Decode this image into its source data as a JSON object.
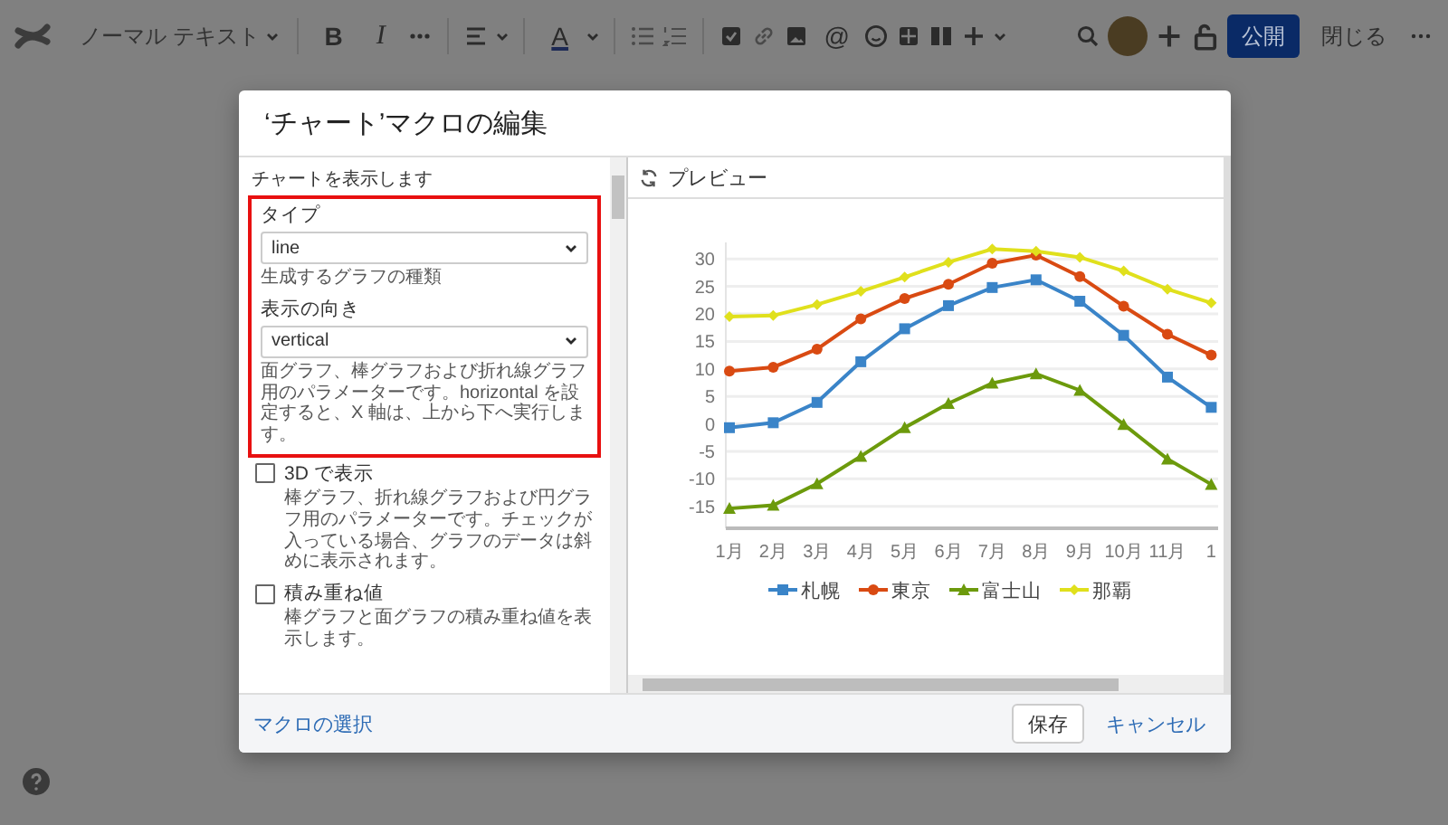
{
  "toolbar": {
    "text_style": "ノーマル テキスト",
    "bold": "B",
    "italic": "I",
    "text_color": "A",
    "mention": "@",
    "publish": "公開",
    "close": "閉じる"
  },
  "dialog": {
    "title": "‘チャート’マクロの編集",
    "intro": "チャートを表示します",
    "fields_highlighted": true,
    "fields": [
      {
        "kind": "select",
        "label": "タイプ",
        "value": "line",
        "help": "生成するグラフの種類"
      },
      {
        "kind": "select",
        "label": "表示の向き",
        "value": "vertical",
        "help": "面グラフ、棒グラフおよび折れ線グラフ用のパラメーターです。horizontal を設定すると、X 軸は、上から下へ実行します。"
      }
    ],
    "options": [
      {
        "label": "3D で表示",
        "checked": false,
        "help": "棒グラフ、折れ線グラフおよび円グラフ用のパラメーターです。チェックが入っている場合、グラフのデータは斜めに表示されます。"
      },
      {
        "label": "積み重ね値",
        "checked": false,
        "help": "棒グラフと面グラフの積み重ね値を表示します。"
      }
    ],
    "preview": {
      "title": "プレビュー",
      "chart_data": {
        "type": "line",
        "categories": [
          "1月",
          "2月",
          "3月",
          "4月",
          "5月",
          "6月",
          "7月",
          "8月",
          "9月",
          "10月",
          "11月",
          "1"
        ],
        "ylim": [
          -19,
          33
        ],
        "yticks": [
          -15,
          -10,
          -5,
          0,
          5,
          10,
          15,
          20,
          25,
          30
        ],
        "grid": true,
        "legend": "bottom",
        "series": [
          {
            "name": "札幌",
            "color": "#3a84c8",
            "marker": "square",
            "values": [
              -0.7,
              0.2,
              3.9,
              11.3,
              17.3,
              21.5,
              24.8,
              26.2,
              22.3,
              16.1,
              8.5,
              3.0
            ]
          },
          {
            "name": "東京",
            "color": "#d94a12",
            "marker": "circle",
            "values": [
              9.6,
              10.3,
              13.6,
              19.1,
              22.8,
              25.4,
              29.2,
              30.7,
              26.8,
              21.4,
              16.3,
              12.5
            ]
          },
          {
            "name": "富士山",
            "color": "#6c9a0c",
            "marker": "triangle",
            "values": [
              -15.4,
              -14.8,
              -10.9,
              -5.9,
              -0.7,
              3.7,
              7.4,
              9.1,
              6.1,
              -0.1,
              -6.4,
              -11.0
            ]
          },
          {
            "name": "那覇",
            "color": "#e0e01c",
            "marker": "diamond",
            "values": [
              19.5,
              19.7,
              21.7,
              24.1,
              26.7,
              29.4,
              31.8,
              31.4,
              30.3,
              27.8,
              24.5,
              22.0
            ]
          }
        ]
      }
    },
    "footer": {
      "link": "マクロの選択",
      "save": "保存",
      "cancel": "キャンセル"
    }
  }
}
